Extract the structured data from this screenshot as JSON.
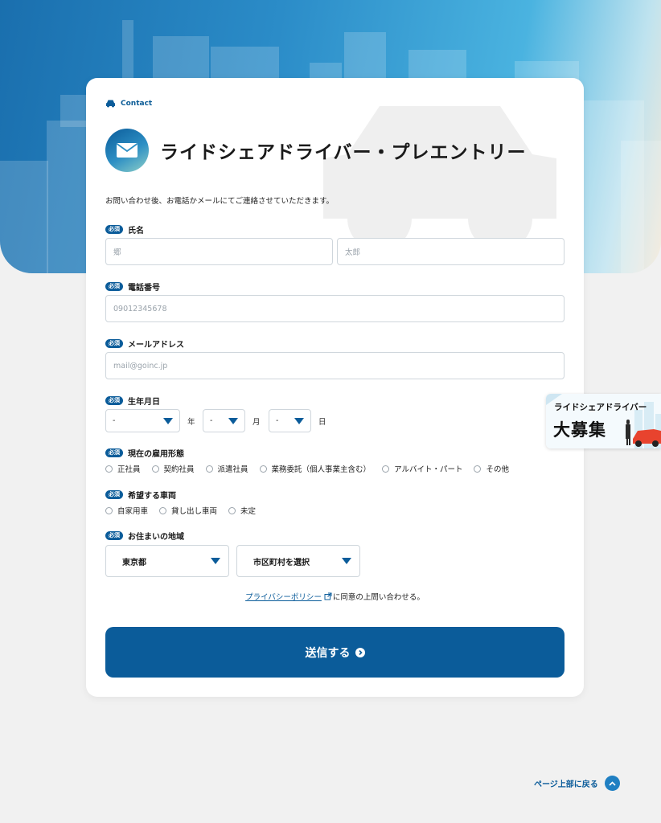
{
  "header": {
    "contact_label": "Contact",
    "title": "ライドシェアドライバー・プレエントリー",
    "lead": "お問い合わせ後、お電話かメールにてご連絡させていただきます。"
  },
  "required_badge": "必須",
  "fields": {
    "name": {
      "label": "氏名",
      "last_placeholder": "郷",
      "first_placeholder": "太郎"
    },
    "phone": {
      "label": "電話番号",
      "placeholder": "09012345678"
    },
    "email": {
      "label": "メールアドレス",
      "placeholder": "mail@goinc.jp"
    },
    "birth": {
      "label": "生年月日",
      "year_value": "-",
      "year_unit": "年",
      "month_value": "-",
      "month_unit": "月",
      "day_value": "-",
      "day_unit": "日"
    },
    "employment": {
      "label": "現在の雇用形態",
      "options": [
        "正社員",
        "契約社員",
        "派遣社員",
        "業務委託（個人事業主含む）",
        "アルバイト・パート",
        "その他"
      ]
    },
    "vehicle": {
      "label": "希望する車両",
      "options": [
        "自家用車",
        "貸し出し車両",
        "未定"
      ]
    },
    "region": {
      "label": "お住まいの地域",
      "prefecture": "東京都",
      "city": "市区町村を選択"
    }
  },
  "privacy": {
    "link": "プライバシーポリシー",
    "suffix": "に同意の上問い合わせる。"
  },
  "submit_label": "送信する",
  "banner": {
    "line1": "ライドシェアドライバー",
    "line2": "大募集"
  },
  "back_to_top": "ページ上部に戻る",
  "colors": {
    "primary": "#0b5c9a",
    "accent": "#1f7fc2",
    "background": "#f1f1f1"
  }
}
